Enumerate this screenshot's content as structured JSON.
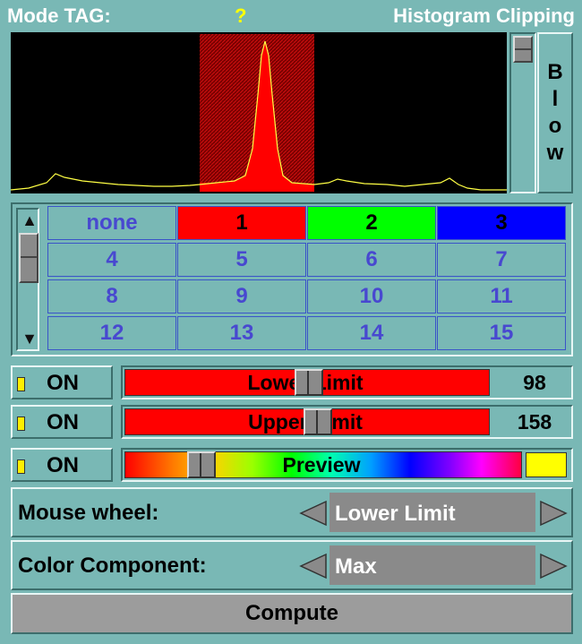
{
  "title": {
    "left": "Mode TAG:",
    "middle": "?",
    "right": "Histogram Clipping"
  },
  "blow_button": {
    "label": [
      "B",
      "l",
      "o",
      "w"
    ]
  },
  "tags": [
    "none",
    "1",
    "2",
    "3",
    "4",
    "5",
    "6",
    "7",
    "8",
    "9",
    "10",
    "11",
    "12",
    "13",
    "14",
    "15"
  ],
  "tag_colors": {
    "1": "#ff0000",
    "2": "#00ff00",
    "3": "#0000ff"
  },
  "lower": {
    "on_label": "ON",
    "slider_label": "Lower Limit",
    "value": "98",
    "color": "#ff0000"
  },
  "upper": {
    "on_label": "ON",
    "slider_label": "Upper Limit",
    "value": "158",
    "color": "#ff0000"
  },
  "preview": {
    "on_label": "ON",
    "slider_label": "Preview",
    "swatch": "#ffff00"
  },
  "mouse_wheel": {
    "label": "Mouse wheel:",
    "value": "Lower Limit"
  },
  "color_component": {
    "label": "Color Component:",
    "value": "Max"
  },
  "compute_label": "Compute",
  "colors": {
    "panel": "#79b8b5",
    "clip_region": "#b00000",
    "histogram_fill": "#ff0000",
    "histogram_line": "#ffff00"
  }
}
